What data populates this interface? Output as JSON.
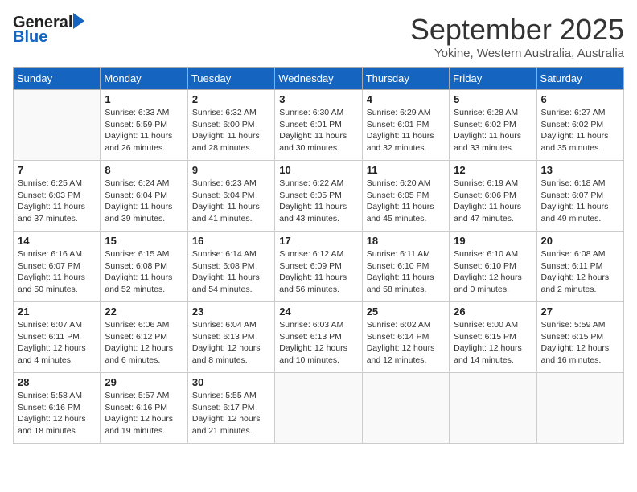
{
  "header": {
    "logo_general": "General",
    "logo_blue": "Blue",
    "month_title": "September 2025",
    "subtitle": "Yokine, Western Australia, Australia"
  },
  "days_of_week": [
    "Sunday",
    "Monday",
    "Tuesday",
    "Wednesday",
    "Thursday",
    "Friday",
    "Saturday"
  ],
  "weeks": [
    [
      {
        "day": "",
        "info": ""
      },
      {
        "day": "1",
        "info": "Sunrise: 6:33 AM\nSunset: 5:59 PM\nDaylight: 11 hours\nand 26 minutes."
      },
      {
        "day": "2",
        "info": "Sunrise: 6:32 AM\nSunset: 6:00 PM\nDaylight: 11 hours\nand 28 minutes."
      },
      {
        "day": "3",
        "info": "Sunrise: 6:30 AM\nSunset: 6:01 PM\nDaylight: 11 hours\nand 30 minutes."
      },
      {
        "day": "4",
        "info": "Sunrise: 6:29 AM\nSunset: 6:01 PM\nDaylight: 11 hours\nand 32 minutes."
      },
      {
        "day": "5",
        "info": "Sunrise: 6:28 AM\nSunset: 6:02 PM\nDaylight: 11 hours\nand 33 minutes."
      },
      {
        "day": "6",
        "info": "Sunrise: 6:27 AM\nSunset: 6:02 PM\nDaylight: 11 hours\nand 35 minutes."
      }
    ],
    [
      {
        "day": "7",
        "info": "Sunrise: 6:25 AM\nSunset: 6:03 PM\nDaylight: 11 hours\nand 37 minutes."
      },
      {
        "day": "8",
        "info": "Sunrise: 6:24 AM\nSunset: 6:04 PM\nDaylight: 11 hours\nand 39 minutes."
      },
      {
        "day": "9",
        "info": "Sunrise: 6:23 AM\nSunset: 6:04 PM\nDaylight: 11 hours\nand 41 minutes."
      },
      {
        "day": "10",
        "info": "Sunrise: 6:22 AM\nSunset: 6:05 PM\nDaylight: 11 hours\nand 43 minutes."
      },
      {
        "day": "11",
        "info": "Sunrise: 6:20 AM\nSunset: 6:05 PM\nDaylight: 11 hours\nand 45 minutes."
      },
      {
        "day": "12",
        "info": "Sunrise: 6:19 AM\nSunset: 6:06 PM\nDaylight: 11 hours\nand 47 minutes."
      },
      {
        "day": "13",
        "info": "Sunrise: 6:18 AM\nSunset: 6:07 PM\nDaylight: 11 hours\nand 49 minutes."
      }
    ],
    [
      {
        "day": "14",
        "info": "Sunrise: 6:16 AM\nSunset: 6:07 PM\nDaylight: 11 hours\nand 50 minutes."
      },
      {
        "day": "15",
        "info": "Sunrise: 6:15 AM\nSunset: 6:08 PM\nDaylight: 11 hours\nand 52 minutes."
      },
      {
        "day": "16",
        "info": "Sunrise: 6:14 AM\nSunset: 6:08 PM\nDaylight: 11 hours\nand 54 minutes."
      },
      {
        "day": "17",
        "info": "Sunrise: 6:12 AM\nSunset: 6:09 PM\nDaylight: 11 hours\nand 56 minutes."
      },
      {
        "day": "18",
        "info": "Sunrise: 6:11 AM\nSunset: 6:10 PM\nDaylight: 11 hours\nand 58 minutes."
      },
      {
        "day": "19",
        "info": "Sunrise: 6:10 AM\nSunset: 6:10 PM\nDaylight: 12 hours\nand 0 minutes."
      },
      {
        "day": "20",
        "info": "Sunrise: 6:08 AM\nSunset: 6:11 PM\nDaylight: 12 hours\nand 2 minutes."
      }
    ],
    [
      {
        "day": "21",
        "info": "Sunrise: 6:07 AM\nSunset: 6:11 PM\nDaylight: 12 hours\nand 4 minutes."
      },
      {
        "day": "22",
        "info": "Sunrise: 6:06 AM\nSunset: 6:12 PM\nDaylight: 12 hours\nand 6 minutes."
      },
      {
        "day": "23",
        "info": "Sunrise: 6:04 AM\nSunset: 6:13 PM\nDaylight: 12 hours\nand 8 minutes."
      },
      {
        "day": "24",
        "info": "Sunrise: 6:03 AM\nSunset: 6:13 PM\nDaylight: 12 hours\nand 10 minutes."
      },
      {
        "day": "25",
        "info": "Sunrise: 6:02 AM\nSunset: 6:14 PM\nDaylight: 12 hours\nand 12 minutes."
      },
      {
        "day": "26",
        "info": "Sunrise: 6:00 AM\nSunset: 6:15 PM\nDaylight: 12 hours\nand 14 minutes."
      },
      {
        "day": "27",
        "info": "Sunrise: 5:59 AM\nSunset: 6:15 PM\nDaylight: 12 hours\nand 16 minutes."
      }
    ],
    [
      {
        "day": "28",
        "info": "Sunrise: 5:58 AM\nSunset: 6:16 PM\nDaylight: 12 hours\nand 18 minutes."
      },
      {
        "day": "29",
        "info": "Sunrise: 5:57 AM\nSunset: 6:16 PM\nDaylight: 12 hours\nand 19 minutes."
      },
      {
        "day": "30",
        "info": "Sunrise: 5:55 AM\nSunset: 6:17 PM\nDaylight: 12 hours\nand 21 minutes."
      },
      {
        "day": "",
        "info": ""
      },
      {
        "day": "",
        "info": ""
      },
      {
        "day": "",
        "info": ""
      },
      {
        "day": "",
        "info": ""
      }
    ]
  ]
}
